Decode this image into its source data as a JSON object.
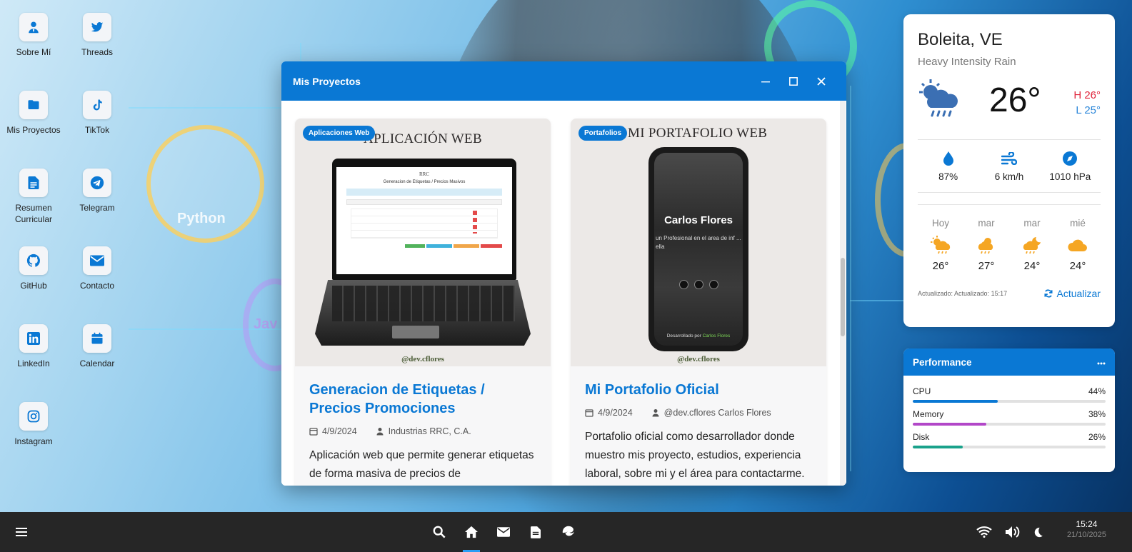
{
  "desktop_icons": [
    {
      "label": "Sobre Mí",
      "icon": "user-tie-icon"
    },
    {
      "label": "Threads",
      "icon": "twitter-icon"
    },
    {
      "label": "Mis Proyectos",
      "icon": "folder-icon"
    },
    {
      "label": "TikTok",
      "icon": "tiktok-icon"
    },
    {
      "label": "Resumen Curricular",
      "icon": "document-icon"
    },
    {
      "label": "Telegram",
      "icon": "telegram-icon"
    },
    {
      "label": "GitHub",
      "icon": "github-icon"
    },
    {
      "label": "Contacto",
      "icon": "envelope-icon"
    },
    {
      "label": "LinkedIn",
      "icon": "linkedin-icon"
    },
    {
      "label": "Calendar",
      "icon": "calendar-icon"
    },
    {
      "label": "Instagram",
      "icon": "instagram-icon"
    }
  ],
  "window": {
    "title": "Mis Proyectos",
    "projects": [
      {
        "badge": "Aplicaciones Web",
        "image_title": "APLICACIÓN WEB",
        "watermark": "@dev.cflores",
        "title": "Generacion de Etiquetas / Precios Promociones",
        "date": "4/9/2024",
        "author": "Industrias RRC, C.A.",
        "description": "Aplicación web que permite generar etiquetas de forma masiva de precios de"
      },
      {
        "badge": "Portafolios",
        "image_title": "MI PORTAFOLIO WEB",
        "watermark": "@dev.cflores",
        "phone_name": "Carlos Flores",
        "phone_sub": "un Profesional en el area de inf ... ella",
        "phone_footer": "Desarrollado por",
        "phone_footer_name": "Carlos Flores",
        "title": "Mi Portafolio Oficial",
        "date": "4/9/2024",
        "author": "@dev.cflores Carlos Flores",
        "description": "Portafolio oficial como desarrollador donde muestro mis proyecto, estudios, experiencia laboral, sobre mi y el área para contactarme."
      }
    ],
    "laptop_screen": {
      "logo": "RRC",
      "heading": "Generacion de Etiquetas / Precios Masivos"
    }
  },
  "weather": {
    "city": "Boleita, VE",
    "condition": "Heavy Intensity Rain",
    "temp": "26°",
    "high": "H 26°",
    "low": "L 25°",
    "humidity": "87%",
    "wind": "6 km/h",
    "pressure": "1010 hPa",
    "forecast": [
      {
        "day": "Hoy",
        "temp": "26°",
        "icon": "sun-cloud-rain-icon"
      },
      {
        "day": "mar",
        "temp": "27°",
        "icon": "sun-cloud-rain-icon"
      },
      {
        "day": "mar",
        "temp": "24°",
        "icon": "moon-cloud-rain-icon"
      },
      {
        "day": "mié",
        "temp": "24°",
        "icon": "cloud-icon"
      }
    ],
    "updated": "Actualizado: Actualizado: 15:17",
    "refresh_label": "Actualizar",
    "colors": {
      "high": "#e0243b",
      "low": "#2a86d9",
      "icon": "#f5a623"
    }
  },
  "performance": {
    "title": "Performance",
    "metrics": [
      {
        "name": "CPU",
        "value": "44%",
        "fraction": 0.44,
        "color": "#0a78d4"
      },
      {
        "name": "Memory",
        "value": "38%",
        "fraction": 0.38,
        "color": "#b247c8"
      },
      {
        "name": "Disk",
        "value": "26%",
        "fraction": 0.26,
        "color": "#1aa28b"
      }
    ]
  },
  "taskbar": {
    "time": "15:24",
    "date": "21/10/2025"
  },
  "wallpaper": {
    "python_label": "Python",
    "java_label": "Jav"
  },
  "accent_color": "#0a78d4"
}
